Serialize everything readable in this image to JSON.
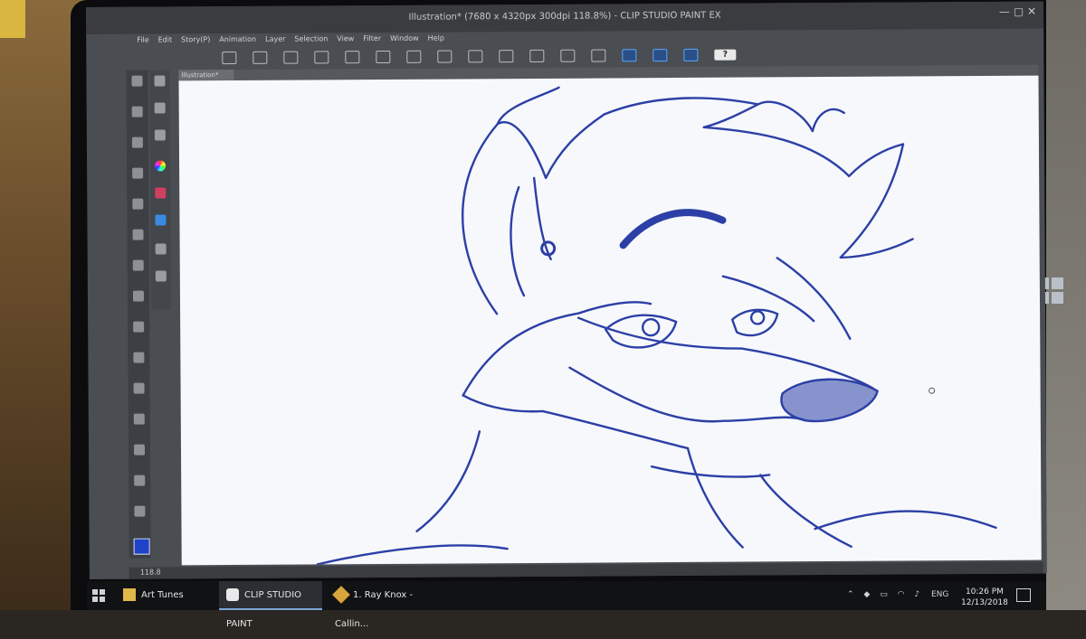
{
  "window": {
    "title": "Illustration* (7680 x 4320px 300dpi 118.8%) - CLIP STUDIO PAINT EX",
    "controls": "— ▢ ✕"
  },
  "menu": [
    "File",
    "Edit",
    "Story(P)",
    "Animation",
    "Layer",
    "Selection",
    "View",
    "Filter",
    "Window",
    "Help"
  ],
  "command_bar": {
    "help_label": "?"
  },
  "document_tab": {
    "label": "Illustration*"
  },
  "status": {
    "zoom": "118.8"
  },
  "colors": {
    "main_color": "#1e42c8",
    "sketch_ink": "#2c3fa6"
  },
  "taskbar": {
    "items": [
      {
        "label": "Art Tunes",
        "icon": "folder-icon"
      },
      {
        "label": "CLIP STUDIO PAINT",
        "icon": "clip-studio-icon"
      },
      {
        "label": "1. Ray Knox - Callin...",
        "icon": "music-app-icon"
      }
    ],
    "tray": {
      "language": "ENG"
    },
    "clock": {
      "time": "10:26 PM",
      "date": "12/13/2018"
    }
  }
}
